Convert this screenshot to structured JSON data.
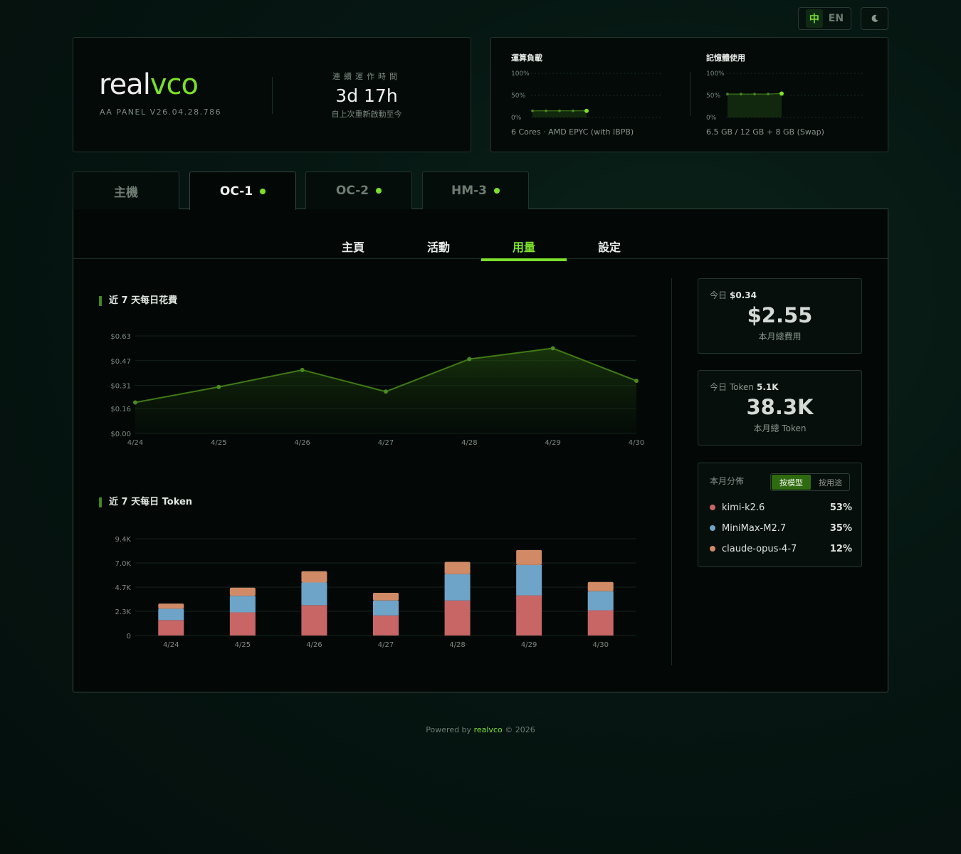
{
  "lang": {
    "zh": "中",
    "en": "EN"
  },
  "brand": {
    "logo_a": "real",
    "logo_b": "vco",
    "version": "AA PANEL V26.04.28.786"
  },
  "uptime": {
    "label": "連續運作時間",
    "value": "3d 17h",
    "sub": "自上次重新啟動至今"
  },
  "system": {
    "cpu": {
      "title": "運算負載",
      "sub": "6 Cores · AMD EPYC (with IBPB)",
      "ticks": [
        "100%",
        "50%",
        "0%"
      ],
      "values": [
        15,
        15,
        15,
        15,
        15
      ]
    },
    "mem": {
      "title": "記憶體使用",
      "sub": "6.5 GB / 12 GB + 8 GB (Swap)",
      "ticks": [
        "100%",
        "50%",
        "0%"
      ],
      "values": [
        53,
        53,
        53,
        53,
        54
      ]
    }
  },
  "hosts": [
    {
      "label": "主機",
      "online": false
    },
    {
      "label": "OC-1",
      "online": true
    },
    {
      "label": "OC-2",
      "online": true
    },
    {
      "label": "HM-3",
      "online": true
    }
  ],
  "subtabs": [
    "主頁",
    "活動",
    "用量",
    "設定"
  ],
  "colors": {
    "accent": "#7be02a",
    "kimi": "#c86666",
    "minimax": "#6ea4c8",
    "claude": "#d08a66"
  },
  "charts": {
    "spend_title": "近 7 天每日花費",
    "token_title": "近 7 天每日 Token"
  },
  "chart_data": [
    {
      "type": "area",
      "title": "近 7 天每日花費",
      "categories": [
        "4/24",
        "4/25",
        "4/26",
        "4/27",
        "4/28",
        "4/29",
        "4/30"
      ],
      "values": [
        0.2,
        0.3,
        0.41,
        0.27,
        0.48,
        0.55,
        0.34
      ],
      "yticks": [
        "$0.00",
        "$0.16",
        "$0.31",
        "$0.47",
        "$0.63"
      ],
      "ylim": [
        0,
        0.63
      ],
      "grid": true
    },
    {
      "type": "bar",
      "stacked": true,
      "title": "近 7 天每日 Token",
      "categories": [
        "4/24",
        "4/25",
        "4/26",
        "4/27",
        "4/28",
        "4/29",
        "4/30"
      ],
      "series": [
        {
          "name": "kimi-k2.6",
          "values": [
            1500,
            2250,
            2950,
            1950,
            3400,
            3900,
            2450
          ]
        },
        {
          "name": "MiniMax-M2.7",
          "values": [
            1100,
            1600,
            2200,
            1450,
            2550,
            2950,
            1850
          ]
        },
        {
          "name": "claude-opus-4-7",
          "values": [
            500,
            800,
            1100,
            750,
            1200,
            1450,
            900
          ]
        }
      ],
      "yticks": [
        "0",
        "2.3K",
        "4.7K",
        "7.0K",
        "9.4K"
      ],
      "ylim": [
        0,
        9400
      ],
      "grid": true
    }
  ],
  "stats": {
    "cost": {
      "today_label": "今日",
      "today_value": "$0.34",
      "big": "$2.55",
      "sub": "本月總費用"
    },
    "token": {
      "today_label": "今日 Token",
      "today_value": "5.1K",
      "big": "38.3K",
      "sub": "本月總 Token"
    }
  },
  "distribution": {
    "title": "本月分佈",
    "toggle_on": "按模型",
    "toggle_off": "按用途",
    "items": [
      {
        "name": "kimi-k2.6",
        "pct": "53%"
      },
      {
        "name": "MiniMax-M2.7",
        "pct": "35%"
      },
      {
        "name": "claude-opus-4-7",
        "pct": "12%"
      }
    ]
  },
  "footer": {
    "pre": "Powered by",
    "brand": "realvco",
    "post": "© 2026"
  }
}
